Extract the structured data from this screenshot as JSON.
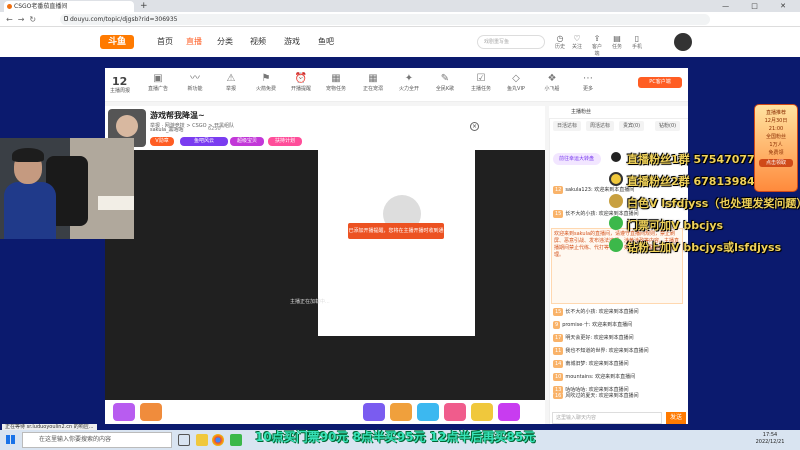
{
  "browser": {
    "tab_title": "CSGO老番茄直播间",
    "url": "douyu.com/topic/djgsb?rid=306935",
    "new_tab": "+",
    "window_controls": "— □ ✕"
  },
  "header": {
    "logo": "斗鱼",
    "nav": [
      "首页",
      "直播",
      "分类",
      "视频",
      "游戏",
      "鱼吧"
    ],
    "search_placeholder": "戏剧重写鱼",
    "icons": [
      {
        "icon": "history-icon",
        "label": "历史"
      },
      {
        "icon": "follow-icon",
        "label": "关注"
      },
      {
        "icon": "upload-icon",
        "label": "客户端"
      },
      {
        "icon": "task-icon",
        "label": "任务"
      },
      {
        "icon": "app-icon",
        "label": "手机"
      }
    ]
  },
  "toolbar": {
    "items": [
      {
        "icon": "calendar-icon",
        "label": "主播周报"
      },
      {
        "icon": "tag-icon",
        "label": "直播广告"
      },
      {
        "icon": "wave-icon",
        "label": "新功能"
      },
      {
        "icon": "warning-icon",
        "label": "举报"
      },
      {
        "icon": "flag-icon",
        "label": "火箭免费"
      },
      {
        "icon": "clock-icon",
        "label": "开播提醒"
      },
      {
        "icon": "gift-icon",
        "label": "宠物任务"
      },
      {
        "icon": "calendar-icon",
        "label": "正在宠溺"
      },
      {
        "icon": "fire-icon",
        "label": "火力全开"
      },
      {
        "icon": "mic-icon",
        "label": "全民K歌"
      },
      {
        "icon": "chart-icon",
        "label": "主播任务"
      },
      {
        "icon": "diamond-icon",
        "label": "鱼丸VIP"
      },
      {
        "icon": "box-icon",
        "label": "小飞船"
      },
      {
        "icon": "more-icon",
        "label": "更多"
      }
    ],
    "calendar_day": "12",
    "pc_button": "PC客户端"
  },
  "room": {
    "title": "游戏帮我降温~",
    "subtitle": "举报 · 网游竞技 > CSGO > 开黑组队",
    "owner": "sakula_黑咕咕",
    "fans": "6250",
    "tags": [
      "V勋章",
      "鱼吧风云",
      "超级宝贝",
      "扶持计划"
    ]
  },
  "player": {
    "popup_button": "已添加开播提醒，您将在主播开播时收到通知",
    "status_text": "主播正在加载中...",
    "close": "×"
  },
  "chat": {
    "header": "主播粉丝",
    "tabs": [
      "日活达标",
      "周活达标",
      "贵宾(0)",
      "钻粉(0)"
    ],
    "banner": "前往幸运大转盘",
    "announcement": "欢迎来到sakula的直播间，请遵守直播间规则，禁止刷屏、恶意引战、发布违法违规、涉黄涉政等内容。主播直播期间禁止代练、代打等行为。如有问题请联系房管处理。",
    "messages": [
      {
        "lv": "12",
        "text": "sakula123: 欢迎来到本直播间"
      },
      {
        "lv": "15",
        "text": "长不大的小孩: 欢迎来到本直播间"
      },
      {
        "lv": "9",
        "text": "promise·十: 欢迎来到本直播间"
      },
      {
        "lv": "17",
        "text": "明天会更好: 欢迎来到本直播间"
      },
      {
        "lv": "11",
        "text": "我也不知道的世界: 欢迎来到本直播间"
      },
      {
        "lv": "14",
        "text": "南城旧梦: 欢迎来到本直播间"
      },
      {
        "lv": "10",
        "text": "mountains: 欢迎来到本直播间"
      },
      {
        "lv": "13",
        "text": "咕咕咕咕: 欢迎来到本直播间"
      },
      {
        "lv": "16",
        "text": "风吹过的夏天: 欢迎来到本直播间"
      },
      {
        "lv": "12",
        "text": "以后还要见: 欢迎来到本直播间"
      }
    ],
    "input_placeholder": "这里输入聊天内容",
    "send": "发送"
  },
  "overlays": {
    "lines": [
      "直播粉丝1群 575470775",
      "直播粉丝2群 678139847",
      "白色V lsfdjyss（也处理发奖问题）",
      "门票可加V bbcjys",
      "钻粉上加V bbcjys或lsfdjyss"
    ],
    "bottom_ticker": "10点买门票90元 8点半买95元 12点半后再买85元",
    "right_banner": [
      "直播推荐",
      "12月30日",
      "21:00",
      "全国粉丝",
      "1万人",
      "免费领",
      "点击领取"
    ]
  },
  "statusbar": "正在等待 sr.luduoyoulin2.cn 的响应...",
  "taskbar": {
    "search_placeholder": "在这里输入你要搜索的内容",
    "time": "17:54",
    "date": "2022/12/21"
  },
  "colors": {
    "accent": "#ff5d23",
    "overlay_text": "#f0d25a",
    "ticker": "#37e3b8",
    "page_bg": "#0b1a6e"
  }
}
